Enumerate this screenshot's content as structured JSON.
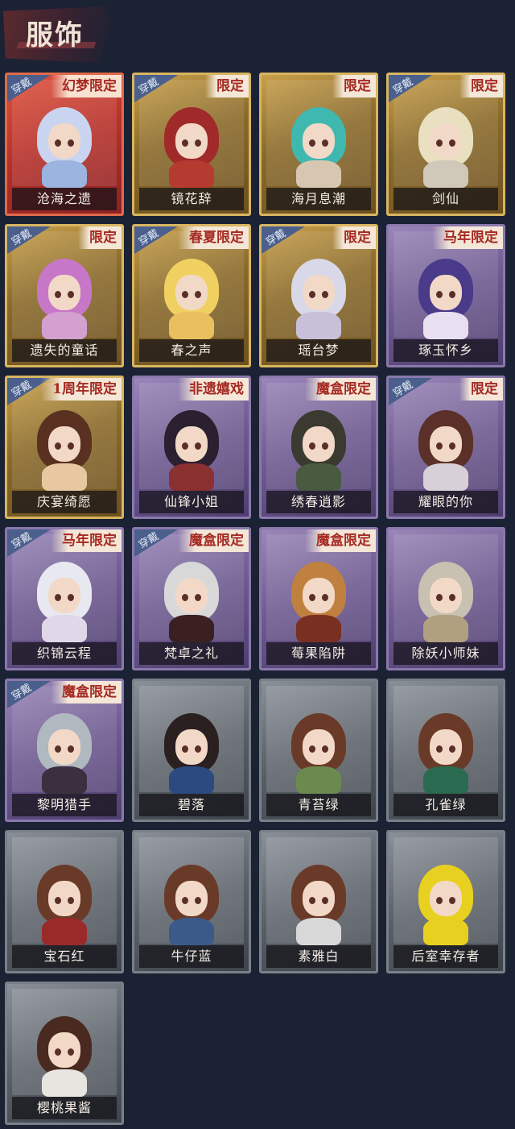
{
  "page": {
    "title": "服饰"
  },
  "wear_label": "穿戴",
  "costumes": [
    {
      "name": "沧海之遗",
      "tag": "幻梦限定",
      "worn": true,
      "rarity": "red",
      "hair": "#c9d4f0",
      "clothes": "#9bb4e0"
    },
    {
      "name": "镜花辞",
      "tag": "限定",
      "worn": true,
      "rarity": "gold",
      "hair": "#a02a2a",
      "clothes": "#b53a30"
    },
    {
      "name": "海月息潮",
      "tag": "限定",
      "worn": false,
      "rarity": "gold",
      "hair": "#3fb9b0",
      "clothes": "#d8c7b0"
    },
    {
      "name": "剑仙",
      "tag": "限定",
      "worn": true,
      "rarity": "gold",
      "hair": "#e8e0c0",
      "clothes": "#d0c8b8"
    },
    {
      "name": "遗失的童话",
      "tag": "限定",
      "worn": true,
      "rarity": "gold",
      "hair": "#c777c8",
      "clothes": "#d4a0d0"
    },
    {
      "name": "春之声",
      "tag": "春夏限定",
      "worn": true,
      "rarity": "gold",
      "hair": "#f0d060",
      "clothes": "#e8c060"
    },
    {
      "name": "瑶台梦",
      "tag": "限定",
      "worn": true,
      "rarity": "gold",
      "hair": "#d8d8e8",
      "clothes": "#c8c0d8"
    },
    {
      "name": "琢玉怀乡",
      "tag": "马年限定",
      "worn": false,
      "rarity": "purple",
      "hair": "#4a3a8a",
      "clothes": "#e8e0f0"
    },
    {
      "name": "庆宴绮愿",
      "tag": "1周年限定",
      "worn": true,
      "rarity": "gold",
      "hair": "#5a3020",
      "clothes": "#e8c8a0"
    },
    {
      "name": "仙锋小姐",
      "tag": "非遗嬉戏",
      "worn": false,
      "rarity": "purple",
      "hair": "#2a2030",
      "clothes": "#8a3030"
    },
    {
      "name": "绣春逍影",
      "tag": "魔盒限定",
      "worn": false,
      "rarity": "purple",
      "hair": "#3a3a30",
      "clothes": "#4a5a40"
    },
    {
      "name": "耀眼的你",
      "tag": "限定",
      "worn": true,
      "rarity": "purple",
      "hair": "#5a3028",
      "clothes": "#d8d0d8"
    },
    {
      "name": "织锦云程",
      "tag": "马年限定",
      "worn": true,
      "rarity": "purple",
      "hair": "#e8e8f0",
      "clothes": "#e0d8e8"
    },
    {
      "name": "梵卓之礼",
      "tag": "魔盒限定",
      "worn": true,
      "rarity": "purple",
      "hair": "#d8d8d8",
      "clothes": "#3a2020"
    },
    {
      "name": "莓果陷阱",
      "tag": "魔盒限定",
      "worn": false,
      "rarity": "purple",
      "hair": "#c08040",
      "clothes": "#7a3020"
    },
    {
      "name": "除妖小师妹",
      "tag": "",
      "worn": false,
      "rarity": "purple",
      "hair": "#c8c0b0",
      "clothes": "#b0a080"
    },
    {
      "name": "黎明猎手",
      "tag": "魔盒限定",
      "worn": true,
      "rarity": "purple",
      "hair": "#b0b8c0",
      "clothes": "#3a3040"
    },
    {
      "name": "碧落",
      "tag": "",
      "worn": false,
      "rarity": "gray",
      "hair": "#2a2020",
      "clothes": "#2a4a80"
    },
    {
      "name": "青苔绿",
      "tag": "",
      "worn": false,
      "rarity": "gray",
      "hair": "#6a3a28",
      "clothes": "#6a8a50"
    },
    {
      "name": "孔雀绿",
      "tag": "",
      "worn": false,
      "rarity": "gray",
      "hair": "#6a3a28",
      "clothes": "#2a6a50"
    },
    {
      "name": "宝石红",
      "tag": "",
      "worn": false,
      "rarity": "gray",
      "hair": "#6a3a28",
      "clothes": "#9a2a2a"
    },
    {
      "name": "牛仔蓝",
      "tag": "",
      "worn": false,
      "rarity": "gray",
      "hair": "#6a3a28",
      "clothes": "#3a5a8a"
    },
    {
      "name": "素雅白",
      "tag": "",
      "worn": false,
      "rarity": "gray",
      "hair": "#6a3a28",
      "clothes": "#d8d8d8"
    },
    {
      "name": "后室幸存者",
      "tag": "",
      "worn": false,
      "rarity": "gray",
      "hair": "#e8d020",
      "clothes": "#e8d020"
    },
    {
      "name": "樱桃果酱",
      "tag": "",
      "worn": false,
      "rarity": "gray",
      "hair": "#4a2a20",
      "clothes": "#e8e4e0"
    }
  ]
}
